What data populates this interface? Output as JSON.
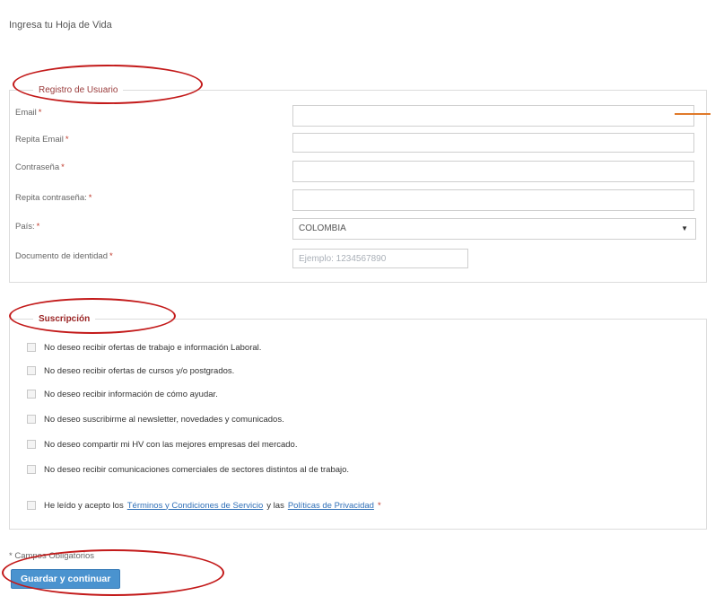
{
  "page": {
    "title": "Ingresa tu Hoja de Vida"
  },
  "registro": {
    "legend": "Registro de Usuario",
    "fields": {
      "email": {
        "label": "Email",
        "value": ""
      },
      "repeat_email": {
        "label": "Repita Email",
        "value": ""
      },
      "password": {
        "label": "Contraseña",
        "value": ""
      },
      "repeat_password": {
        "label": "Repita contraseña:",
        "value": ""
      },
      "country": {
        "label": "País:",
        "value": "COLOMBIA"
      },
      "document": {
        "label": "Documento de identidad",
        "placeholder": "Ejemplo: 1234567890",
        "value": ""
      }
    },
    "required_mark": "*"
  },
  "suscripcion": {
    "legend": "Suscripción",
    "options": [
      "No deseo recibir ofertas de trabajo e información Laboral.",
      "No deseo recibir ofertas de cursos y/o postgrados.",
      "No deseo recibir información de cómo ayudar.",
      "No deseo suscribirme al newsletter, novedades y comunicados.",
      "No deseo compartir mi HV con las mejores empresas del mercado.",
      "No deseo recibir comunicaciones comerciales de sectores distintos al de trabajo."
    ],
    "terms": {
      "prefix": "He leído y acepto los",
      "link1": "Términos y Condiciones de Servicio",
      "middle": "y las",
      "link2": "Políticas de Privacidad",
      "suffix": "*"
    }
  },
  "footer": {
    "required_note": "* Campos Obligatorios",
    "save_label": "Guardar y continuar"
  },
  "colors": {
    "annotation_red": "#c31a1a",
    "accent_orange": "#e07a2a",
    "button_blue": "#4a93cf",
    "link_blue": "#2f6fb7"
  }
}
